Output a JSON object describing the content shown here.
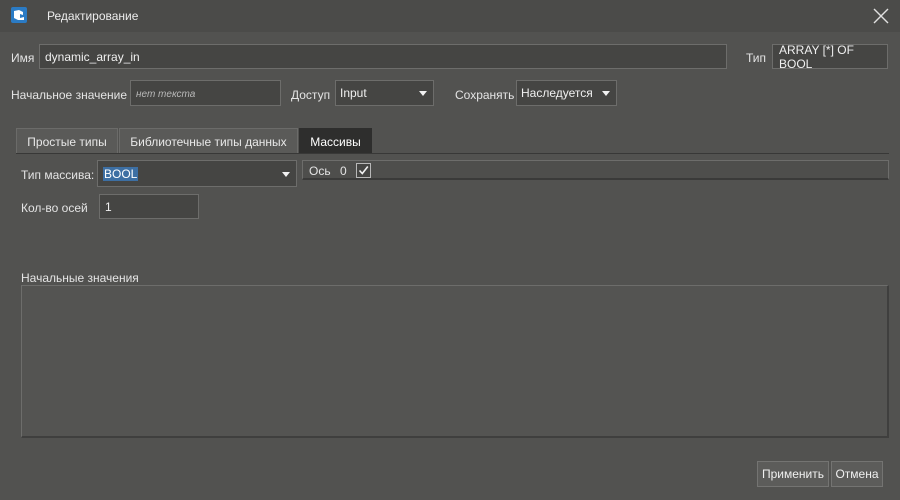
{
  "window": {
    "title": "Редактирование",
    "app_icon": "app-logo-icon",
    "close_icon": "close-icon"
  },
  "name_row": {
    "name_label": "Имя",
    "name_value": "dynamic_array_in",
    "type_label": "Тип",
    "type_value": "ARRAY [*] OF BOOL"
  },
  "params_row": {
    "initial_label": "Начальное значение",
    "initial_placeholder": "нет текста",
    "access_label": "Доступ",
    "access_value": "Input",
    "save_label": "Сохранять",
    "save_value": "Наследуется"
  },
  "tabs": [
    {
      "label": "Простые типы",
      "active": false
    },
    {
      "label": "Библиотечные типы данных",
      "active": false
    },
    {
      "label": "Массивы",
      "active": true
    }
  ],
  "array_panel": {
    "array_type_label": "Тип массива:",
    "array_type_value": "BOOL",
    "axis_label": "Ось",
    "axis_index": "0",
    "axis_checked": true,
    "axes_count_label": "Кол-во осей",
    "axes_count_value": "1",
    "initial_values_label": "Начальные значения"
  },
  "buttons": {
    "apply": "Применить",
    "cancel": "Отмена"
  },
  "colors": {
    "background": "#525250",
    "field": "#454543",
    "active_tab": "#2e2e2d",
    "selection": "#3d6fa3"
  }
}
